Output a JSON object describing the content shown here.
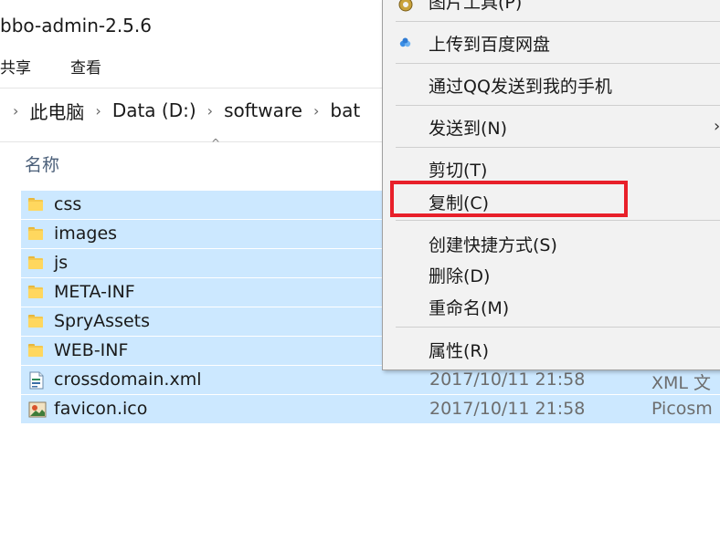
{
  "window": {
    "title": "bbo-admin-2.5.6"
  },
  "ribbon": {
    "share_tab": "共享",
    "view_tab": "查看"
  },
  "address": {
    "crumbs": [
      "此电脑",
      "Data (D:)",
      "software",
      "bat"
    ]
  },
  "columns": {
    "name_header": "名称"
  },
  "files": [
    {
      "name": "css",
      "kind": "folder",
      "icon": "folder-icon"
    },
    {
      "name": "images",
      "kind": "folder",
      "icon": "folder-icon"
    },
    {
      "name": "js",
      "kind": "folder",
      "icon": "folder-icon"
    },
    {
      "name": "META-INF",
      "kind": "folder",
      "icon": "folder-icon"
    },
    {
      "name": "SpryAssets",
      "kind": "folder",
      "icon": "folder-icon"
    },
    {
      "name": "WEB-INF",
      "kind": "folder",
      "icon": "folder-icon"
    },
    {
      "name": "crossdomain.xml",
      "kind": "file",
      "icon": "xml-file-icon",
      "date": "2017/10/11 21:58",
      "type": "XML 文"
    },
    {
      "name": "favicon.ico",
      "kind": "file",
      "icon": "image-file-icon",
      "date": "2017/10/11 21:58",
      "type": "Picosm"
    }
  ],
  "context_menu": {
    "items": {
      "image_tool": "图片工具(P)",
      "upload_baidu": "上传到百度网盘",
      "send_qq": "通过QQ发送到我的手机",
      "send_to": "发送到(N)",
      "cut": "剪切(T)",
      "copy": "复制(C)",
      "create_shortcut": "创建快捷方式(S)",
      "delete": "删除(D)",
      "rename": "重命名(M)",
      "properties": "属性(R)"
    },
    "highlight_color": "#e8202a",
    "submenu_arrow": "›"
  },
  "colors": {
    "selection": "#cce8ff",
    "menu_bg": "#f2f2f2"
  }
}
